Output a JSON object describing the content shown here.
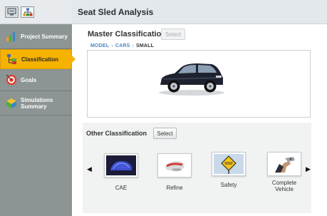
{
  "header": {
    "title": "Seat Sled Analysis"
  },
  "toolbar": {
    "buttons": [
      {
        "icon": "monitor-icon"
      },
      {
        "icon": "hierarchy-icon"
      }
    ]
  },
  "sidebar": {
    "items": [
      {
        "label": "Project Summary",
        "icon": "bar-chart-icon",
        "selected": false
      },
      {
        "label": "Classification",
        "icon": "tree-icon",
        "selected": true
      },
      {
        "label": "Goals",
        "icon": "target-icon",
        "selected": false
      },
      {
        "label": "Simulations Summary",
        "icon": "cube-icon",
        "selected": false
      }
    ]
  },
  "master": {
    "title": "Master Classification",
    "select_label": "Select",
    "breadcrumb": [
      "MODEL",
      "CARS",
      "SMALL"
    ],
    "image": "car-icon"
  },
  "other": {
    "title": "Other Classification",
    "select_label": "Select",
    "prev": "◀",
    "next": "▶",
    "items": [
      {
        "label": "CAE",
        "icon": "cae-mesh-icon"
      },
      {
        "label": "Refine",
        "icon": "refine-icon"
      },
      {
        "label": "Safety",
        "icon": "safety-sign-icon"
      },
      {
        "label": "Complete Vehicle",
        "icon": "complete-vehicle-icon"
      }
    ]
  }
}
